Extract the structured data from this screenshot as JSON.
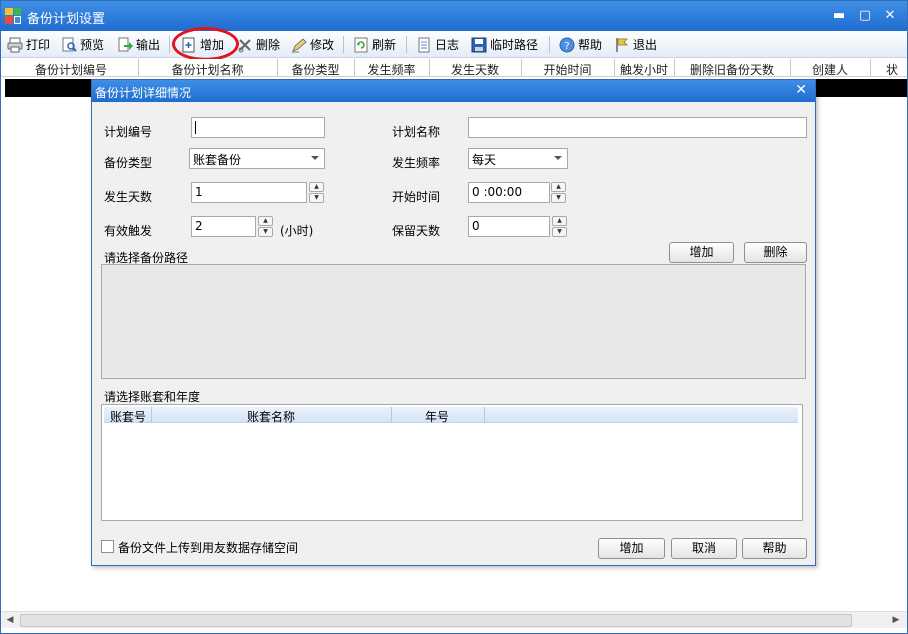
{
  "window": {
    "title": "备份计划设置",
    "controls": {
      "minimize": "▬",
      "maximize": "▢",
      "close": "✕"
    }
  },
  "toolbar": {
    "items": [
      {
        "label": "打印",
        "icon": "printer-icon"
      },
      {
        "label": "预览",
        "icon": "preview-icon"
      },
      {
        "label": "输出",
        "icon": "export-icon"
      },
      {
        "label": "增加",
        "icon": "add-icon"
      },
      {
        "label": "删除",
        "icon": "delete-icon"
      },
      {
        "label": "修改",
        "icon": "edit-icon"
      },
      {
        "label": "刷新",
        "icon": "refresh-icon"
      },
      {
        "label": "日志",
        "icon": "log-icon"
      },
      {
        "label": "临时路径",
        "icon": "save-icon"
      },
      {
        "label": "帮助",
        "icon": "help-icon"
      },
      {
        "label": "退出",
        "icon": "exit-icon"
      }
    ]
  },
  "grid": {
    "columns": [
      "备份计划编号",
      "备份计划名称",
      "备份类型",
      "发生频率",
      "发生天数",
      "开始时间",
      "触发小时",
      "删除旧备份天数",
      "创建人",
      "状"
    ]
  },
  "dialog": {
    "title": "备份计划详细情况",
    "close": "✕",
    "fields": {
      "plan_no_label": "计划编号",
      "plan_no_value": "",
      "plan_name_label": "计划名称",
      "plan_name_value": "",
      "backup_type_label": "备份类型",
      "backup_type_value": "账套备份",
      "frequency_label": "发生频率",
      "frequency_value": "每天",
      "days_label": "发生天数",
      "days_value": "1",
      "start_time_label": "开始时间",
      "start_time_value": "0 :00:00",
      "trigger_label": "有效触发",
      "trigger_value": "2",
      "trigger_unit": "(小时)",
      "keep_days_label": "保留天数",
      "keep_days_value": "0"
    },
    "path_section": {
      "label": "请选择备份路径",
      "add": "增加",
      "delete": "删除"
    },
    "account_section": {
      "label": "请选择账套和年度",
      "columns": [
        "账套号",
        "账套名称",
        "年号"
      ]
    },
    "upload_checkbox": {
      "label": "备份文件上传到用友数据存储空间",
      "checked": false
    },
    "buttons": {
      "add": "增加",
      "cancel": "取消",
      "help": "帮助"
    }
  },
  "scrollbar": {
    "left": "◀",
    "right": "▶"
  }
}
